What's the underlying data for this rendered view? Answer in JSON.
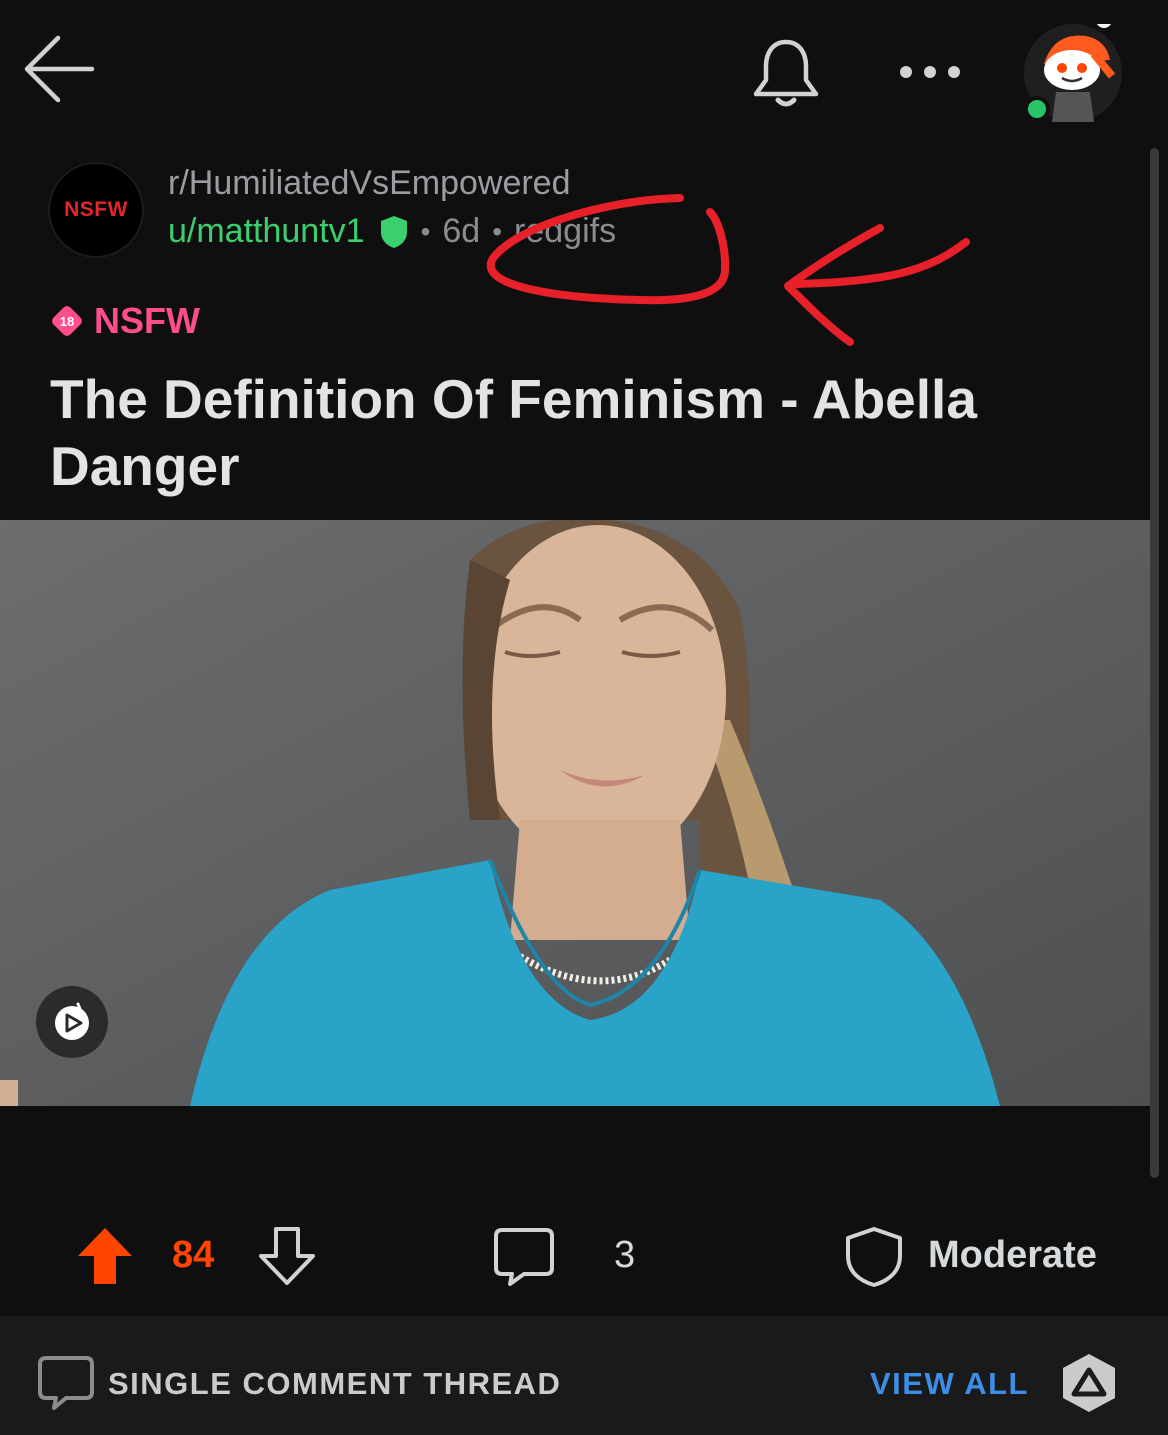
{
  "topbar": {
    "back_icon": "back-arrow-icon",
    "notification_icon": "bell-icon",
    "more_icon": "more-horizontal-icon",
    "avatar_icon": "snoo-avatar-icon",
    "online_status": "online"
  },
  "post": {
    "subreddit_avatar_text": "NSFW",
    "subreddit": "r/HumiliatedVsEmpowered",
    "author": "u/matthuntv1",
    "age": "6d",
    "domain": "redgifs",
    "nsfw_badge_number": "18",
    "nsfw_label": "NSFW",
    "title": "The Definition Of Feminism - Abella Danger",
    "media_type_icon": "video-play-icon"
  },
  "actions": {
    "score": "84",
    "comments": "3",
    "moderate_label": "Moderate"
  },
  "bottombar": {
    "thread_label": "SINGLE COMMENT THREAD",
    "view_all_label": "VIEW ALL"
  },
  "colors": {
    "background": "#0f0f0f",
    "upvote": "#ff4500",
    "username": "#3bd06f",
    "nsfw": "#ff4d8d",
    "link": "#3d8ee6",
    "annotation": "#e8202a"
  }
}
